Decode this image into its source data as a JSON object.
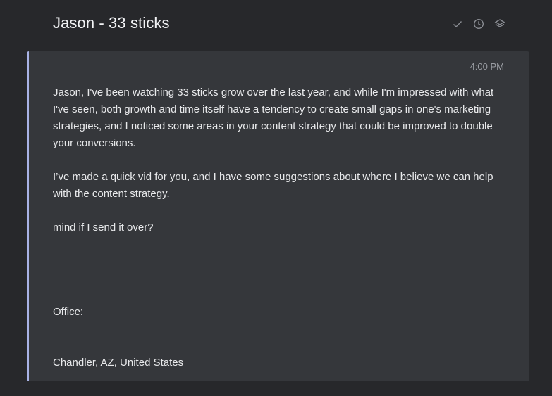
{
  "header": {
    "title": "Jason - 33 sticks",
    "actions": [
      {
        "icon": "check-icon"
      },
      {
        "icon": "clock-icon"
      },
      {
        "icon": "layers-icon"
      }
    ]
  },
  "message": {
    "time": "4:00 PM",
    "paragraphs": [
      "Jason, I've been watching 33 sticks grow over the last year, and while I'm impressed with what I've seen, both growth and time itself have a tendency to create small gaps in one's marketing strategies, and I noticed some areas in your content strategy that could be improved to double your conversions.",
      "I’ve made a quick vid for you, and I have some suggestions about where I believe we can help with the content strategy.",
      "mind if I send it over?",
      "Office:",
      "Chandler, AZ, United States"
    ]
  },
  "colors": {
    "background": "#27282b",
    "card": "#35373b",
    "accent_border": "#a9b3e6"
  }
}
